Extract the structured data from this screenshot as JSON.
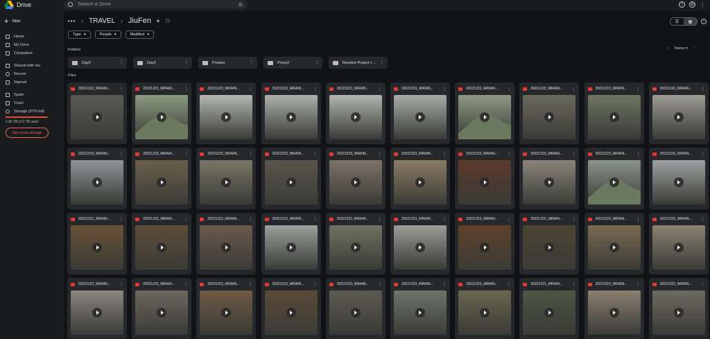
{
  "app": {
    "name": "Drive"
  },
  "search": {
    "placeholder": "Search in Drive"
  },
  "sidebar": {
    "new_label": "New",
    "items": [
      {
        "label": "Home",
        "icon": "home-icon"
      },
      {
        "label": "My Drive",
        "icon": "my-drive-icon"
      },
      {
        "label": "Computers",
        "icon": "computers-icon"
      },
      {
        "label": "Shared with me",
        "icon": "shared-icon"
      },
      {
        "label": "Recent",
        "icon": "clock-icon"
      },
      {
        "label": "Starred",
        "icon": "star-icon"
      },
      {
        "label": "Spam",
        "icon": "spam-icon"
      },
      {
        "label": "Trash",
        "icon": "trash-icon"
      },
      {
        "label": "Storage (97% full)",
        "icon": "cloud-icon"
      }
    ],
    "storage_text": "1.95 TB of 2 TB used",
    "storage_fraction": 0.97,
    "get_storage_label": "Get more storage"
  },
  "breadcrumb": {
    "parent": "TRAVEL",
    "current": "JiuFen"
  },
  "filters": [
    "Type",
    "People",
    "Modified"
  ],
  "sections": {
    "folders": "Folders",
    "files": "Files"
  },
  "sort": {
    "label": "Name"
  },
  "folders": [
    "Day2",
    "Day3",
    "Proxies",
    "Proxy2",
    "Resolve Project + ..."
  ],
  "file_label": "20221222_WRAIN...",
  "file_label_alt": "20221223_WRAIN...",
  "thumbs": [
    [
      "#5a5a55",
      "#8a9a80",
      "#b4b6b2",
      "#aeb0ab",
      "#b1b3ae",
      "#a9aca6",
      "#8d9a84",
      "#6b6a5f",
      "#6f7462",
      "#9d9c95"
    ],
    [
      "#8f9597",
      "#6b5f4a",
      "#7a7567",
      "#5a554c",
      "#7d7268",
      "#8a7d64",
      "#5c3a2a",
      "#8a847a",
      "#8a9488",
      "#9fa2a1"
    ],
    [
      "#6a5236",
      "#5f4d3a",
      "#6a5a4c",
      "#9aa09c",
      "#6f7261",
      "#9c9c97",
      "#5e4229",
      "#4c4533",
      "#7b6a52",
      "#8c8372"
    ],
    [
      "#8b8680",
      "#6d675d",
      "#6f5a44",
      "#5a4a38",
      "#5d5a52",
      "#707568",
      "#6a6650",
      "#4f5544",
      "#8b7f72",
      "#6f6a60"
    ]
  ]
}
